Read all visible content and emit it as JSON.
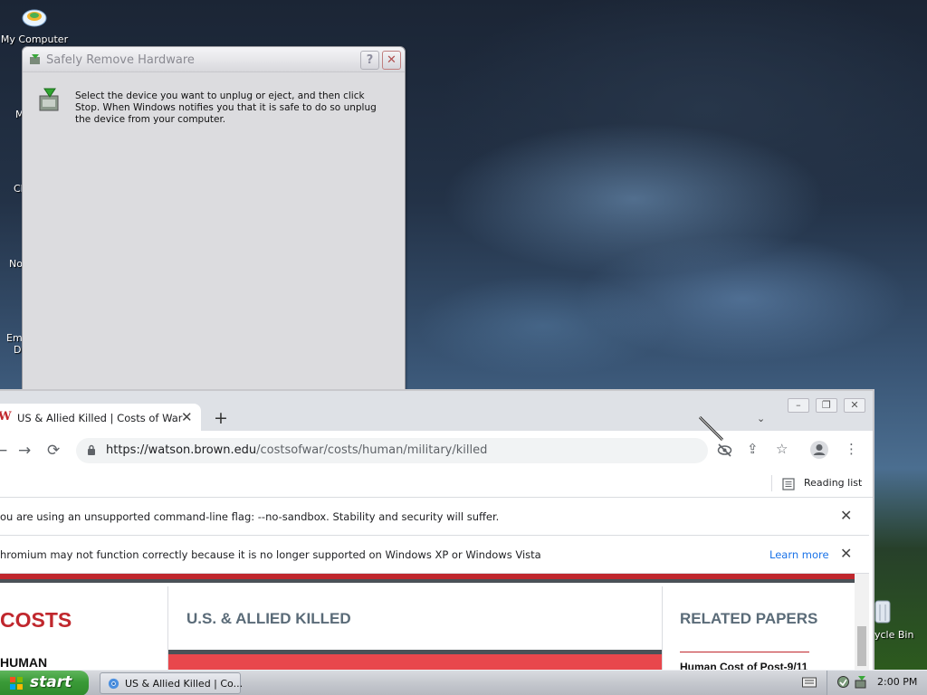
{
  "desktop": {
    "my_computer_label": "My Computer",
    "partial_labels": [
      "M",
      "Ch",
      "No",
      "Emb",
      "De"
    ],
    "recycle_bin_label": "ycle Bin"
  },
  "srh_window": {
    "title": "Safely Remove Hardware",
    "help_label": "?",
    "close_label": "✕",
    "instruction": "Select the device you want to unplug or eject, and then click Stop. When Windows notifies you that it is safe to do so unplug the device from your computer."
  },
  "chrome": {
    "frame_buttons": {
      "minimize": "–",
      "restore": "❐",
      "close": "✕"
    },
    "tab": {
      "favicon": "W",
      "title": "US & Allied Killed | Costs of War",
      "close": "✕"
    },
    "new_tab": "+",
    "tab_menu": "⌄",
    "nav": {
      "back": "←",
      "forward": "→",
      "reload": "⟳"
    },
    "url": {
      "host": "https://watson.brown.edu",
      "path": "/costsofwar/costs/human/military/killed"
    },
    "toolbar_icons": {
      "share": "⇪",
      "star": "☆",
      "menu": "⋮"
    },
    "reading_list": "Reading list",
    "infobars": [
      {
        "message": "ou are using an unsupported command-line flag: --no-sandbox. Stability and security will suffer.",
        "link": "",
        "close": "✕"
      },
      {
        "message": "hromium may not function correctly because it is no longer supported on Windows XP or Windows Vista",
        "link": "Learn more",
        "close": "✕"
      }
    ]
  },
  "page": {
    "left_heading": "COSTS",
    "left_sub": "HUMAN",
    "main_heading": "U.S. & ALLIED KILLED",
    "related_heading": "RELATED PAPERS",
    "related_first": "Human Cost of Post-9/11"
  },
  "taskbar": {
    "start_label": "start",
    "task_label": "US & Allied Killed | Co...",
    "clock": "2:00 PM"
  },
  "colors": {
    "accent_red": "#c0272d",
    "link_blue": "#1a73e8",
    "start_green": "#3a9a37"
  }
}
